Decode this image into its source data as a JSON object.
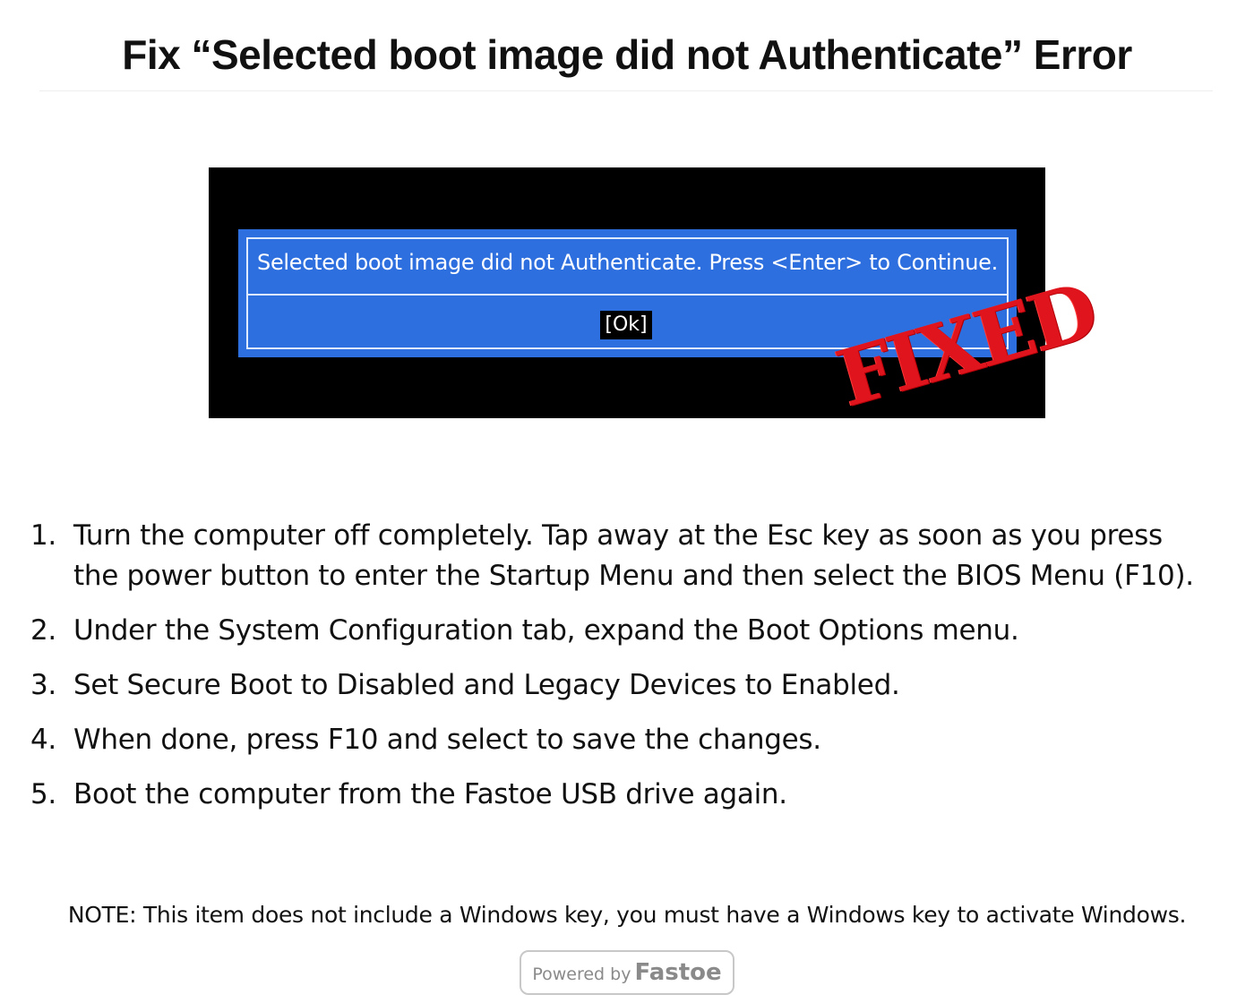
{
  "header": {
    "title": "Fix “Selected boot image did not Authenticate” Error"
  },
  "bios_dialog": {
    "message": "Selected boot image did not Authenticate. Press <Enter> to Continue.",
    "ok_label": "[Ok]"
  },
  "stamp": {
    "text": "FIXED",
    "color": "#e0141c"
  },
  "steps": [
    {
      "number": "1.",
      "text": "Turn the computer off completely. Tap away at the Esc key as soon as you press the power button to enter the Startup Menu and then select the BIOS Menu (F10)."
    },
    {
      "number": "2.",
      "text": "Under the System Configuration tab, expand the Boot Options menu."
    },
    {
      "number": "3.",
      "text": "Set Secure Boot to Disabled and Legacy Devices to Enabled."
    },
    {
      "number": "4.",
      "text": "When done, press F10 and select to save the changes."
    },
    {
      "number": "5.",
      "text": "Boot the computer from the Fastoe USB drive again."
    }
  ],
  "note": "NOTE: This item does not include a Windows key, you must have a Windows key to activate Windows.",
  "footer": {
    "powered_by": "Powered by",
    "brand": "Fastoe"
  },
  "colors": {
    "dialog_blue": "#2e6fe0",
    "screen_black": "#000000",
    "stamp_red": "#e0141c"
  }
}
